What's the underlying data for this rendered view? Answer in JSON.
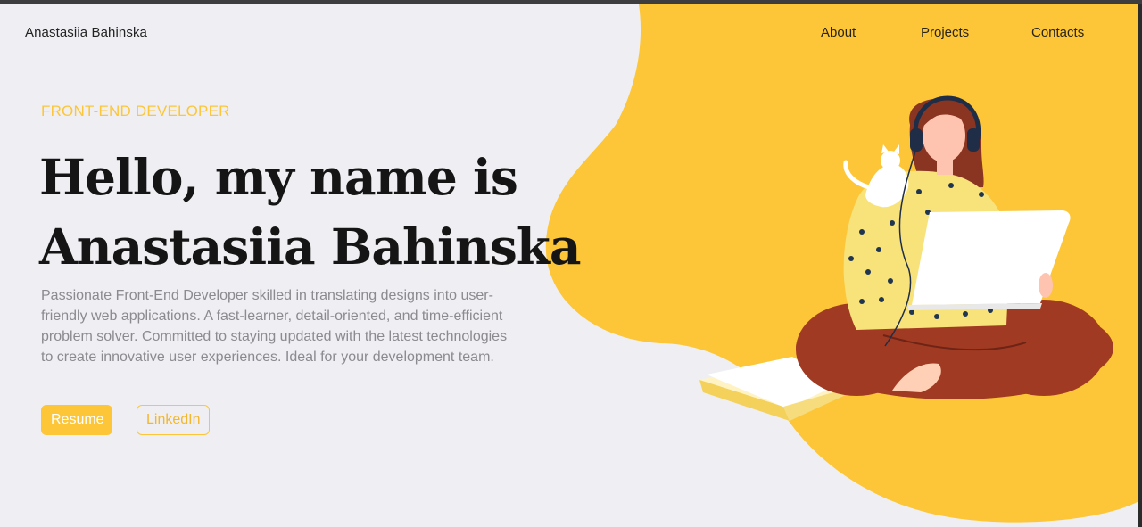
{
  "header": {
    "brand": "Anastasiia Bahinska",
    "nav": [
      "About",
      "Projects",
      "Contacts"
    ]
  },
  "hero": {
    "role": "FRONT-END DEVELOPER",
    "headline_line1": "Hello, my name is",
    "headline_line2": "Anastasiia Bahinska",
    "bio": "Passionate Front-End Developer skilled in translating designs into user-friendly web applications. A fast-learner, detail-oriented, and time-efficient problem solver. Committed to staying updated with the latest technologies to create innovative user experiences. Ideal for your development team.",
    "buttons": {
      "resume": "Resume",
      "linkedin": "LinkedIn"
    }
  },
  "illustration": {
    "subject": "woman-with-laptop-headphones-cat-book"
  },
  "colors": {
    "accent": "#fcc638",
    "background": "#efeff3",
    "text_dark": "#151515",
    "text_muted": "#8a8a8f",
    "pants": "#a13a22"
  }
}
